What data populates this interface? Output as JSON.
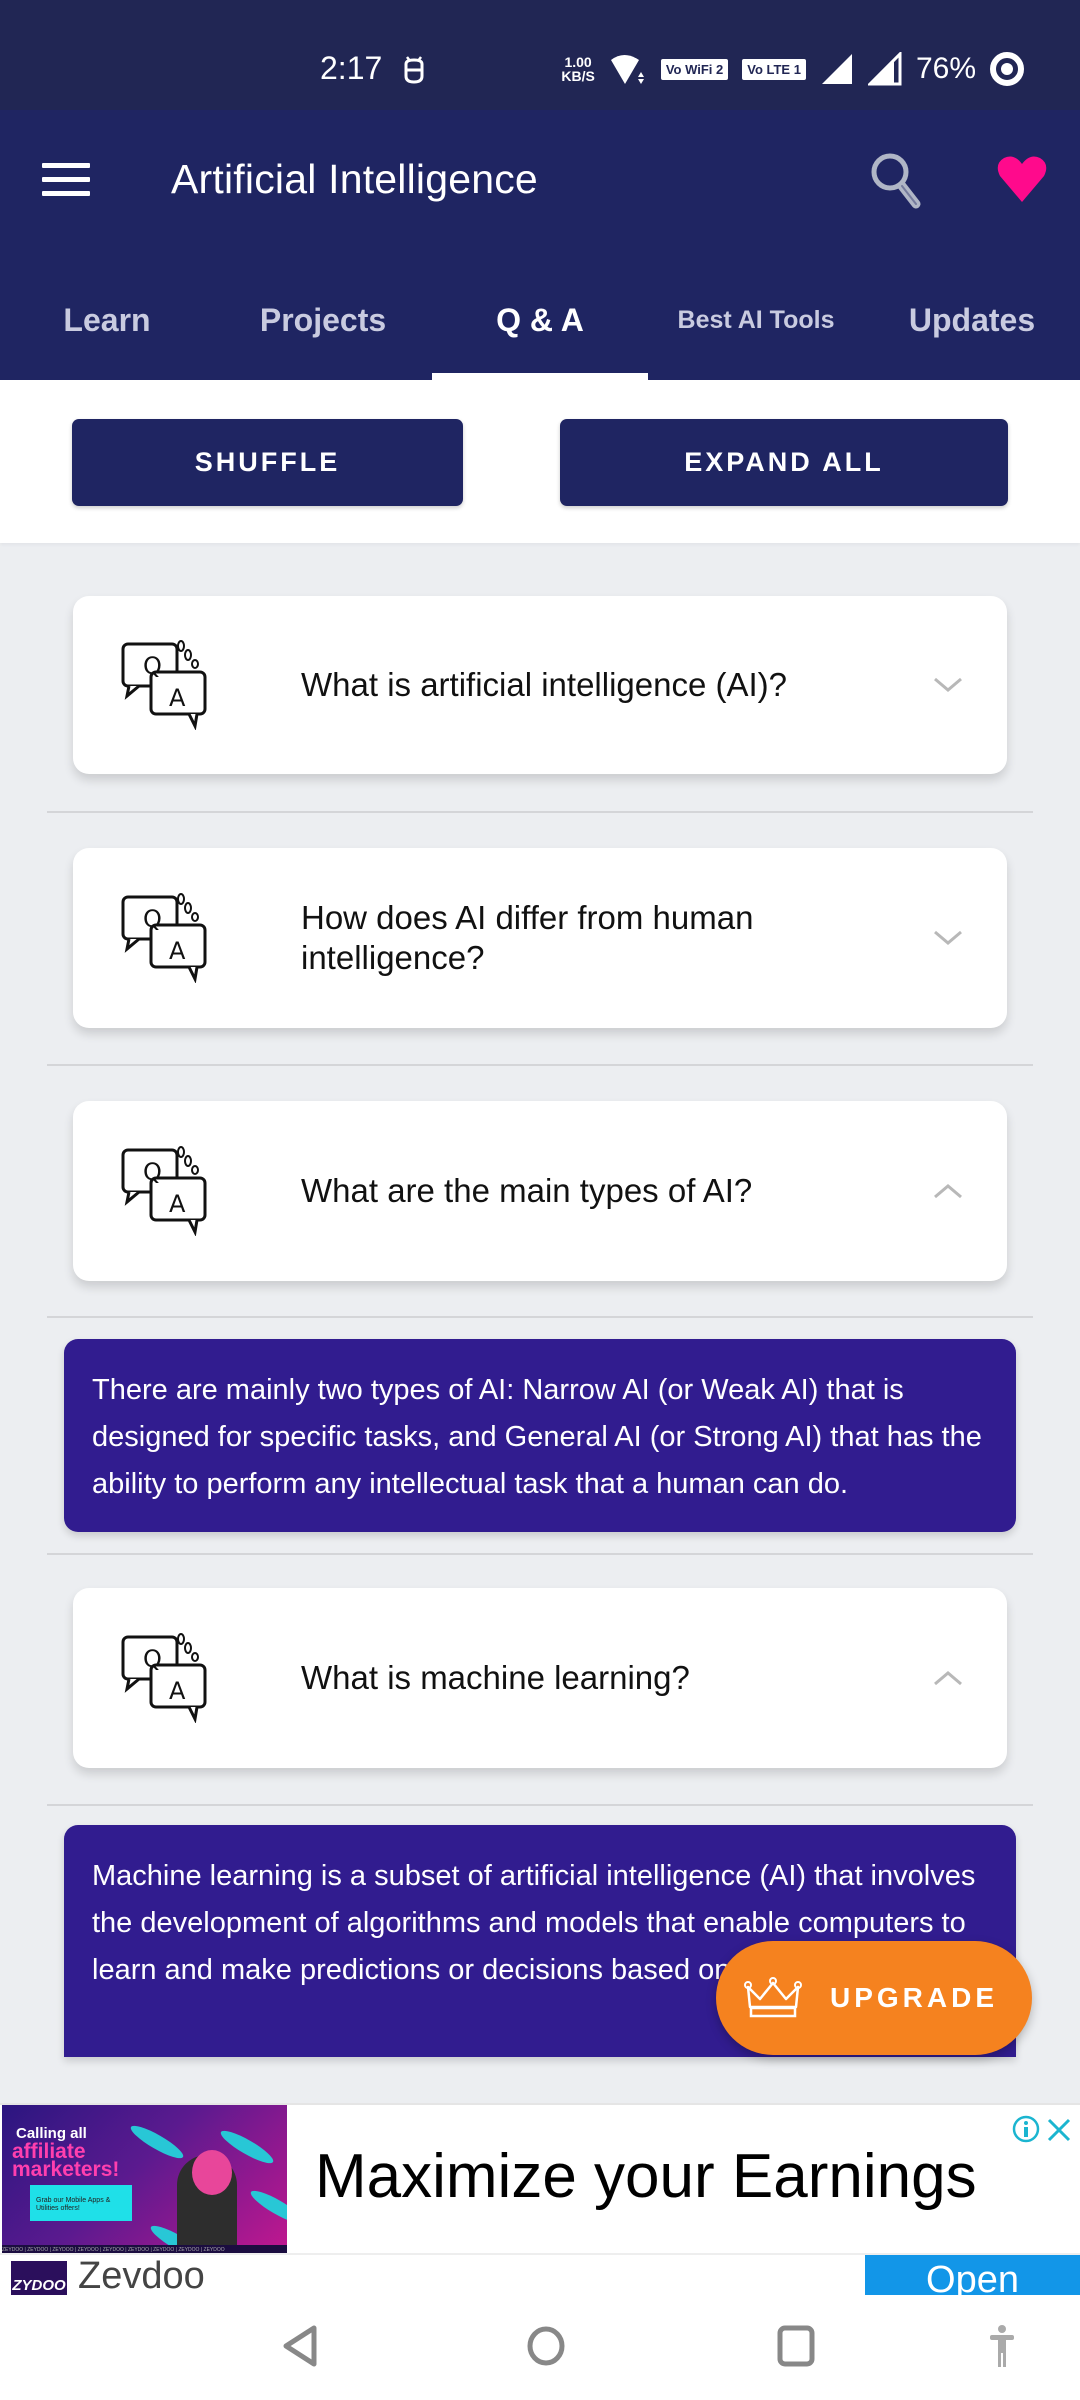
{
  "status_bar": {
    "time": "2:17",
    "net_speed_value": "1.00",
    "net_speed_unit": "KB/S",
    "wifi_badge": "Vo WiFi 2",
    "lte_badge": "Vo LTE 1",
    "battery": "76%"
  },
  "app_bar": {
    "title": "Artificial Intelligence",
    "favorite_color": "#ff0a8c"
  },
  "tabs": [
    {
      "label": "Learn",
      "active": false
    },
    {
      "label": "Projects",
      "active": false
    },
    {
      "label": "Q & A",
      "active": true
    },
    {
      "label": "Best AI Tools",
      "active": false
    },
    {
      "label": "Updates",
      "active": false
    }
  ],
  "actions": {
    "shuffle": "SHUFFLE",
    "expand_all": "EXPAND ALL"
  },
  "qa": [
    {
      "question": "What is artificial intelligence (AI)?",
      "expanded": false
    },
    {
      "question": "How does AI differ from human intelligence?",
      "expanded": false
    },
    {
      "question": "What are the main types of AI?",
      "expanded": true,
      "answer": "There are mainly two types of AI: Narrow AI (or Weak AI) that is designed for specific tasks, and General AI (or Strong AI) that has the ability to perform any intellectual task that a human can do."
    },
    {
      "question": "What is machine learning?",
      "expanded": true,
      "answer": "Machine learning is a subset of artificial intelligence (AI) that involves the development of algorithms and models that enable computers to learn and make predictions or decisions based on data."
    }
  ],
  "upgrade": {
    "label": "UPGRADE",
    "color": "#f5821f"
  },
  "ad": {
    "image_line1": "Calling all",
    "image_line2": "affiliate marketers!",
    "image_cta": "Grab our Mobile Apps & Utilities offers!",
    "image_strip": "ZEYDOO | ZEYDOO | ZEYDOO | ZEYDOO | ZEYDOO | ZEYDOO | ZEYDOO | ZEYDOO | ZEYDOO",
    "headline": "Maximize your Earnings",
    "logo_text": "ZYDOO",
    "brand": "Zevdoo",
    "open_label": "Open"
  },
  "colors": {
    "primary": "#1f2562",
    "answer_bg": "#311c8f",
    "accent_cyan": "#1bb5d0"
  }
}
